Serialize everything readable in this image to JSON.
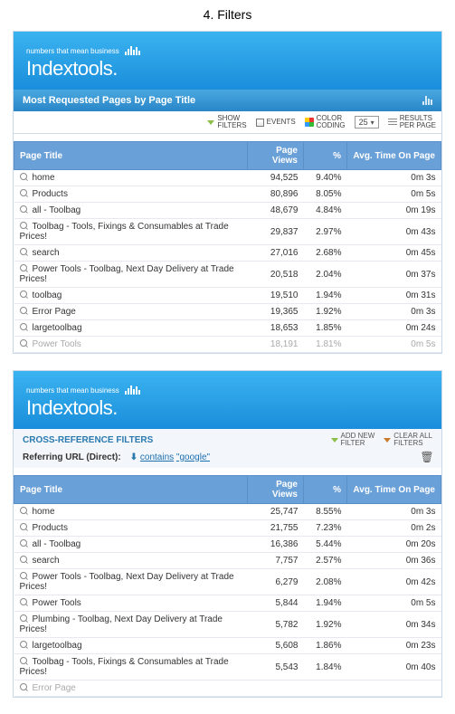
{
  "heading": "4. Filters",
  "brand_tagline": "numbers that mean business",
  "brand_name": "Indextools.",
  "report_title": "Most Requested Pages by Page Title",
  "toolbar": {
    "show_filters": "SHOW\nFILTERS",
    "events": "EVENTS",
    "color_coding": "COLOR\nCODING",
    "per_page_value": "25",
    "results_per_page": "RESULTS\nPER PAGE"
  },
  "columns": {
    "title": "Page Title",
    "views": "Page Views",
    "pct": "%",
    "time": "Avg. Time On Page"
  },
  "table1": [
    {
      "title": "home",
      "views": "94,525",
      "pct": "9.40%",
      "time": "0m 3s"
    },
    {
      "title": "Products",
      "views": "80,896",
      "pct": "8.05%",
      "time": "0m 5s"
    },
    {
      "title": "all - Toolbag",
      "views": "48,679",
      "pct": "4.84%",
      "time": "0m 19s"
    },
    {
      "title": "Toolbag - Tools, Fixings & Consumables at Trade Prices!",
      "views": "29,837",
      "pct": "2.97%",
      "time": "0m 43s"
    },
    {
      "title": "search",
      "views": "27,016",
      "pct": "2.68%",
      "time": "0m 45s"
    },
    {
      "title": "Power Tools - Toolbag, Next Day Delivery at Trade Prices!",
      "views": "20,518",
      "pct": "2.04%",
      "time": "0m 37s"
    },
    {
      "title": "toolbag",
      "views": "19,510",
      "pct": "1.94%",
      "time": "0m 31s"
    },
    {
      "title": "Error Page",
      "views": "19,365",
      "pct": "1.92%",
      "time": "0m 3s"
    },
    {
      "title": "largetoolbag",
      "views": "18,653",
      "pct": "1.85%",
      "time": "0m 24s"
    },
    {
      "title": "Power Tools",
      "views": "18,191",
      "pct": "1.81%",
      "time": "0m 5s"
    }
  ],
  "filters": {
    "section_title": "CROSS-REFERENCE FILTERS",
    "add_new": "ADD NEW\nFILTER",
    "clear_all": "CLEAR ALL\nFILTERS",
    "field_label": "Referring URL (Direct):",
    "operator": "contains",
    "value": "\"google\""
  },
  "table2": [
    {
      "title": "home",
      "views": "25,747",
      "pct": "8.55%",
      "time": "0m 3s"
    },
    {
      "title": "Products",
      "views": "21,755",
      "pct": "7.23%",
      "time": "0m 2s"
    },
    {
      "title": "all - Toolbag",
      "views": "16,386",
      "pct": "5.44%",
      "time": "0m 20s"
    },
    {
      "title": "search",
      "views": "7,757",
      "pct": "2.57%",
      "time": "0m 36s"
    },
    {
      "title": "Power Tools - Toolbag, Next Day Delivery at Trade Prices!",
      "views": "6,279",
      "pct": "2.08%",
      "time": "0m 42s"
    },
    {
      "title": "Power Tools",
      "views": "5,844",
      "pct": "1.94%",
      "time": "0m 5s"
    },
    {
      "title": "Plumbing - Toolbag, Next Day Delivery at Trade Prices!",
      "views": "5,782",
      "pct": "1.92%",
      "time": "0m 34s"
    },
    {
      "title": "largetoolbag",
      "views": "5,608",
      "pct": "1.86%",
      "time": "0m 23s"
    },
    {
      "title": "Toolbag - Tools, Fixings & Consumables at Trade Prices!",
      "views": "5,543",
      "pct": "1.84%",
      "time": "0m 40s"
    },
    {
      "title": "Error Page",
      "views": "",
      "pct": "",
      "time": ""
    }
  ]
}
